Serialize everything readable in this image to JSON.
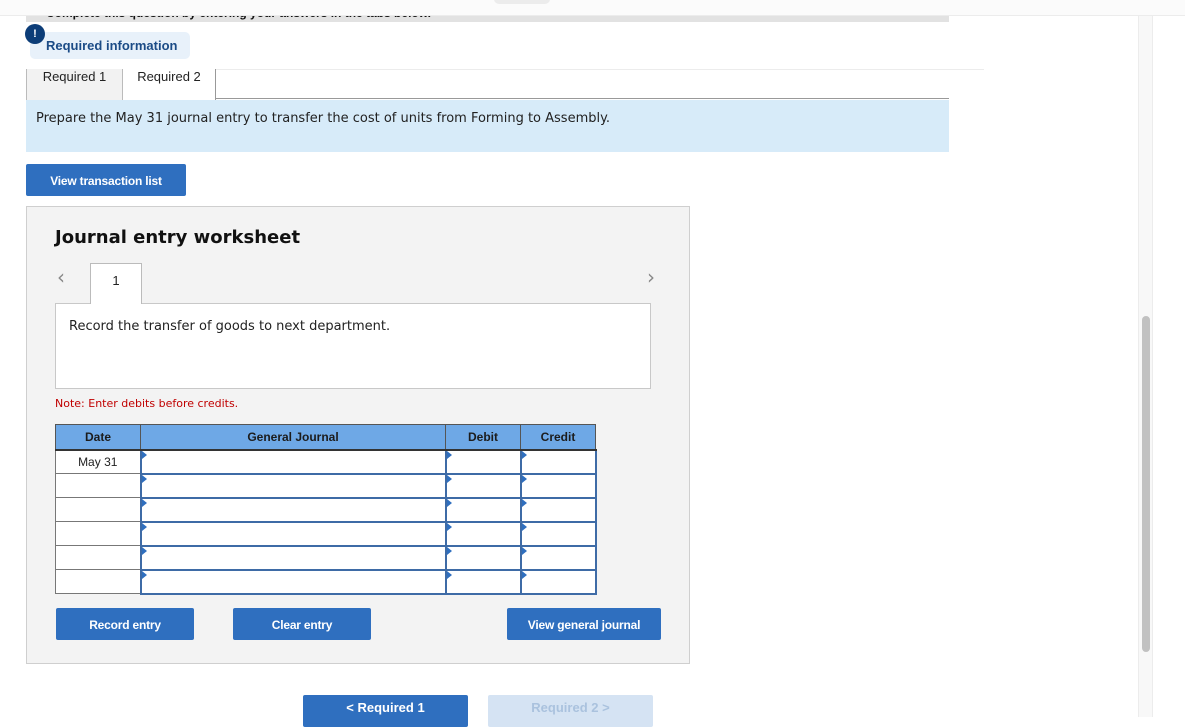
{
  "header": {
    "instructions": "Complete this question by entering your answers in the tabs below."
  },
  "required_info": {
    "badge": "!",
    "label": "Required information"
  },
  "tabs": [
    {
      "label": "Required 1",
      "active": false
    },
    {
      "label": "Required 2",
      "active": true
    }
  ],
  "prompt": "Prepare the May 31 journal entry to transfer the cost of units from Forming to Assembly.",
  "view_transaction_list": "View transaction list",
  "worksheet": {
    "title": "Journal entry worksheet",
    "prev_icon": "chevron-left-icon",
    "next_icon": "chevron-right-icon",
    "prev_glyph": "<",
    "next_glyph": ">",
    "entry_tab": "1",
    "description": "Record the transfer of goods to next department.",
    "note": "Note: Enter debits before credits.",
    "table": {
      "headers": [
        "Date",
        "General Journal",
        "Debit",
        "Credit"
      ],
      "rows": [
        {
          "date": "May 31",
          "account": "",
          "debit": "",
          "credit": ""
        },
        {
          "date": "",
          "account": "",
          "debit": "",
          "credit": ""
        },
        {
          "date": "",
          "account": "",
          "debit": "",
          "credit": ""
        },
        {
          "date": "",
          "account": "",
          "debit": "",
          "credit": ""
        },
        {
          "date": "",
          "account": "",
          "debit": "",
          "credit": ""
        },
        {
          "date": "",
          "account": "",
          "debit": "",
          "credit": ""
        }
      ]
    },
    "buttons": {
      "record": "Record entry",
      "clear": "Clear entry",
      "view_gj": "View general journal"
    }
  },
  "navigation": {
    "prev": "< Required 1",
    "next": "Required 2 >"
  },
  "colors": {
    "accent": "#2f6fbf",
    "header_blue": "#6ea8e6",
    "prompt_bg": "#d7ebf9",
    "note_red": "#c00000"
  }
}
